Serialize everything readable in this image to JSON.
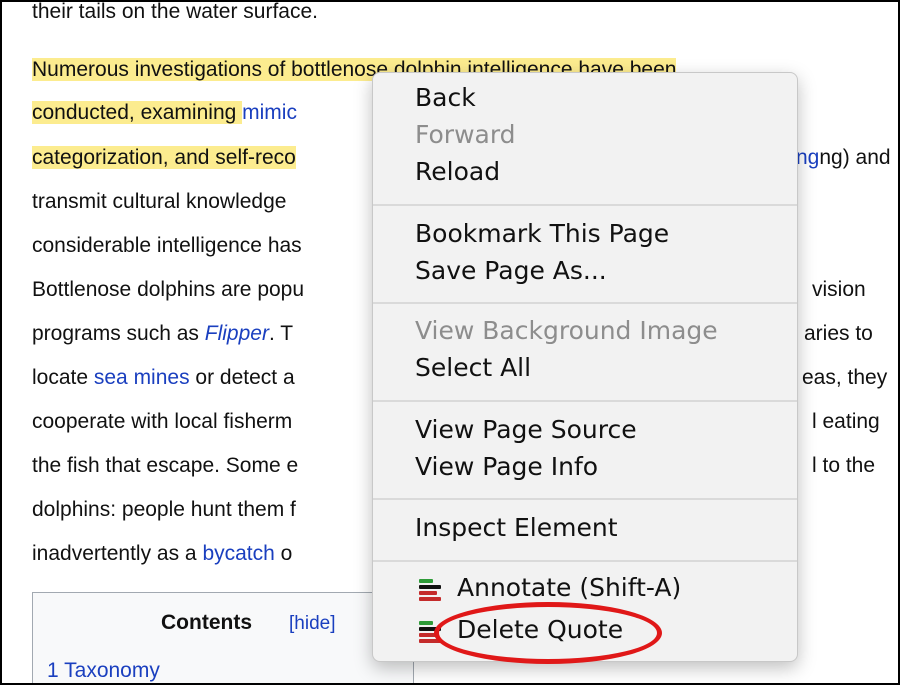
{
  "article": {
    "top_fragment": "their tails on the water surface.",
    "lines": [
      {
        "parts": [
          {
            "t": "Numerous investigations of bottlenose dolphin intelligence have been",
            "hl": true
          }
        ]
      },
      {
        "parts": [
          {
            "t": "conducted, examining ",
            "hl": true
          },
          {
            "t": "mimic",
            "link": true
          }
        ]
      },
      {
        "parts": [
          {
            "t": "categorization, and self-reco",
            "hl": true
          }
        ]
      },
      {
        "parts": [
          {
            "t": "transmit cultural knowledge "
          }
        ]
      },
      {
        "parts": [
          {
            "t": "considerable intelligence has"
          }
        ]
      },
      {
        "parts": [
          {
            "t": "Bottlenose dolphins are popu"
          }
        ]
      },
      {
        "parts": [
          {
            "t": "programs such as "
          },
          {
            "t": "Flipper",
            "link": true,
            "ital": true
          },
          {
            "t": ". T"
          }
        ]
      },
      {
        "parts": [
          {
            "t": "locate "
          },
          {
            "t": "sea mines",
            "link": true
          },
          {
            "t": " or detect a"
          }
        ]
      },
      {
        "parts": [
          {
            "t": "cooperate with local fisherm"
          }
        ]
      },
      {
        "parts": [
          {
            "t": "the fish that escape. Some e"
          }
        ]
      },
      {
        "parts": [
          {
            "t": "dolphins: people hunt them f"
          }
        ]
      },
      {
        "parts": [
          {
            "t": "inadvertently as a "
          },
          {
            "t": "bycatch",
            "link": true
          },
          {
            "t": " o"
          }
        ]
      }
    ],
    "right_tails": {
      "line3": "ng) and",
      "line7": "vision",
      "line8": "aries to",
      "line9": "eas, they",
      "line10": "l eating",
      "line11": "l to the"
    }
  },
  "contents": {
    "title": "Contents",
    "hide": "[hide]",
    "first_item": "1 Taxonomy"
  },
  "context_menu": {
    "back": "Back",
    "forward": "Forward",
    "reload": "Reload",
    "bookmark": "Bookmark This Page",
    "save_as": "Save Page As...",
    "view_bg": "View Background Image",
    "select_all": "Select All",
    "view_source": "View Page Source",
    "view_info": "View Page Info",
    "inspect": "Inspect Element",
    "annotate": "Annotate (Shift-A)",
    "delete_quote": "Delete Quote"
  },
  "colors": {
    "highlight": "#fcec8f",
    "link": "#1a3fbf",
    "callout": "#e01818"
  }
}
